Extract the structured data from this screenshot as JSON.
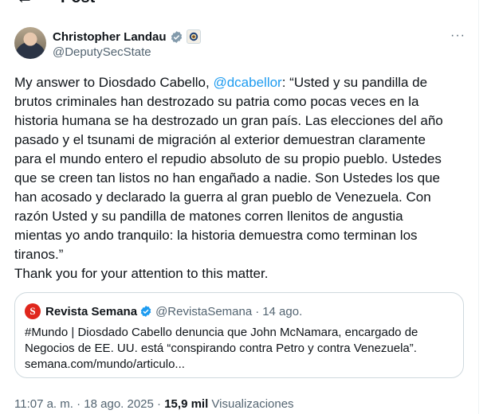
{
  "header": {
    "back_icon": "arrow-left-icon",
    "title": "Post"
  },
  "author": {
    "name": "Christopher Landau",
    "handle": "@DeputySecState",
    "verified_icon": "verified-badge-icon",
    "affiliation_icon": "state-department-seal-icon",
    "more_label": "···"
  },
  "tweet": {
    "intro": "My answer to Diosdado Cabello, ",
    "mention": "@dcabellor",
    "body": ": “Usted y su pandilla de\nbrutos criminales han destrozado su patria como pocas veces en la\nhistoria humana se ha destrozado un gran país. Las elecciones del año\npasado y el tsunami de migración al exterior demuestran claramente\npara el mundo entero el repudio absoluto de su propio pueblo. Ustedes\nque se creen tan listos no han engañado a nadie. Son Ustedes los que\nhan acosado y declarado la guerra al gran pueblo de Venezuela. Con\nrazón Usted y su pandilla de matones corren llenitos de angustia\nmientas yo ando tranquilo: la historia demuestra como terminan los\ntiranos.”\nThank you for your attention to this matter."
  },
  "quote": {
    "avatar_letter": "S",
    "name": "Revista Semana",
    "handle": "@RevistaSemana",
    "separator": "·",
    "date": "14 ago.",
    "text": "#Mundo | Diosdado Cabello denuncia que John McNamara, encargado de\nNegocios de EE. UU. está “conspirando contra Petro y contra Venezuela”.\nsemana.com/mundo/articulo..."
  },
  "meta": {
    "time": "11:07 a. m.",
    "sep1": " · ",
    "date": "18 ago. 2025",
    "sep2": " · ",
    "views_count": "15,9 mil",
    "views_label": " Visualizaciones"
  },
  "colors": {
    "accent": "#1d9bf0",
    "secondary_text": "#536471",
    "border": "#cfd9de",
    "semana_red": "#e0261c"
  }
}
